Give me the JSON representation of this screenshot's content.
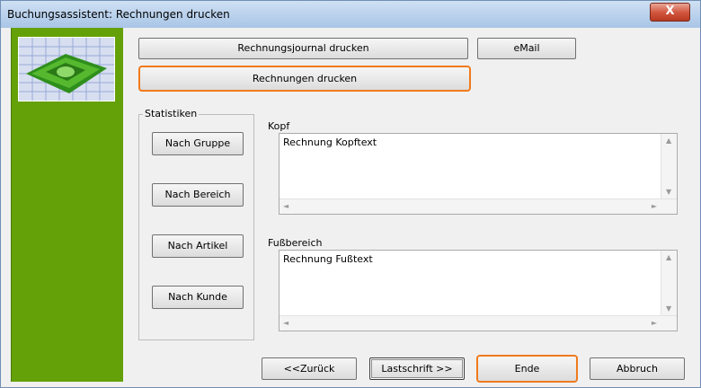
{
  "window": {
    "title": "Buchungsassistent: Rechnungen drucken",
    "close_glyph": "X"
  },
  "top_buttons": {
    "journal": "Rechnungsjournal drucken",
    "email": "eMail",
    "invoices": "Rechnungen drucken"
  },
  "statistics": {
    "legend": "Statistiken",
    "by_group": "Nach Gruppe",
    "by_area": "Nach Bereich",
    "by_article": "Nach Artikel",
    "by_customer": "Nach Kunde"
  },
  "header_section": {
    "label": "Kopf",
    "text": "Rechnung Kopftext"
  },
  "footer_section": {
    "label": "Fußbereich",
    "text": "Rechnung Fußtext"
  },
  "nav": {
    "back": "<<Zurück",
    "next": "Lastschrift >>",
    "finish": "Ende",
    "cancel": "Abbruch"
  },
  "icons": {
    "logo": "invoice-banknote-logo",
    "up": "▲",
    "down": "▼",
    "left": "◄",
    "right": "►"
  },
  "colors": {
    "sidebar": "#64a108",
    "highlight": "#f07a1c"
  }
}
